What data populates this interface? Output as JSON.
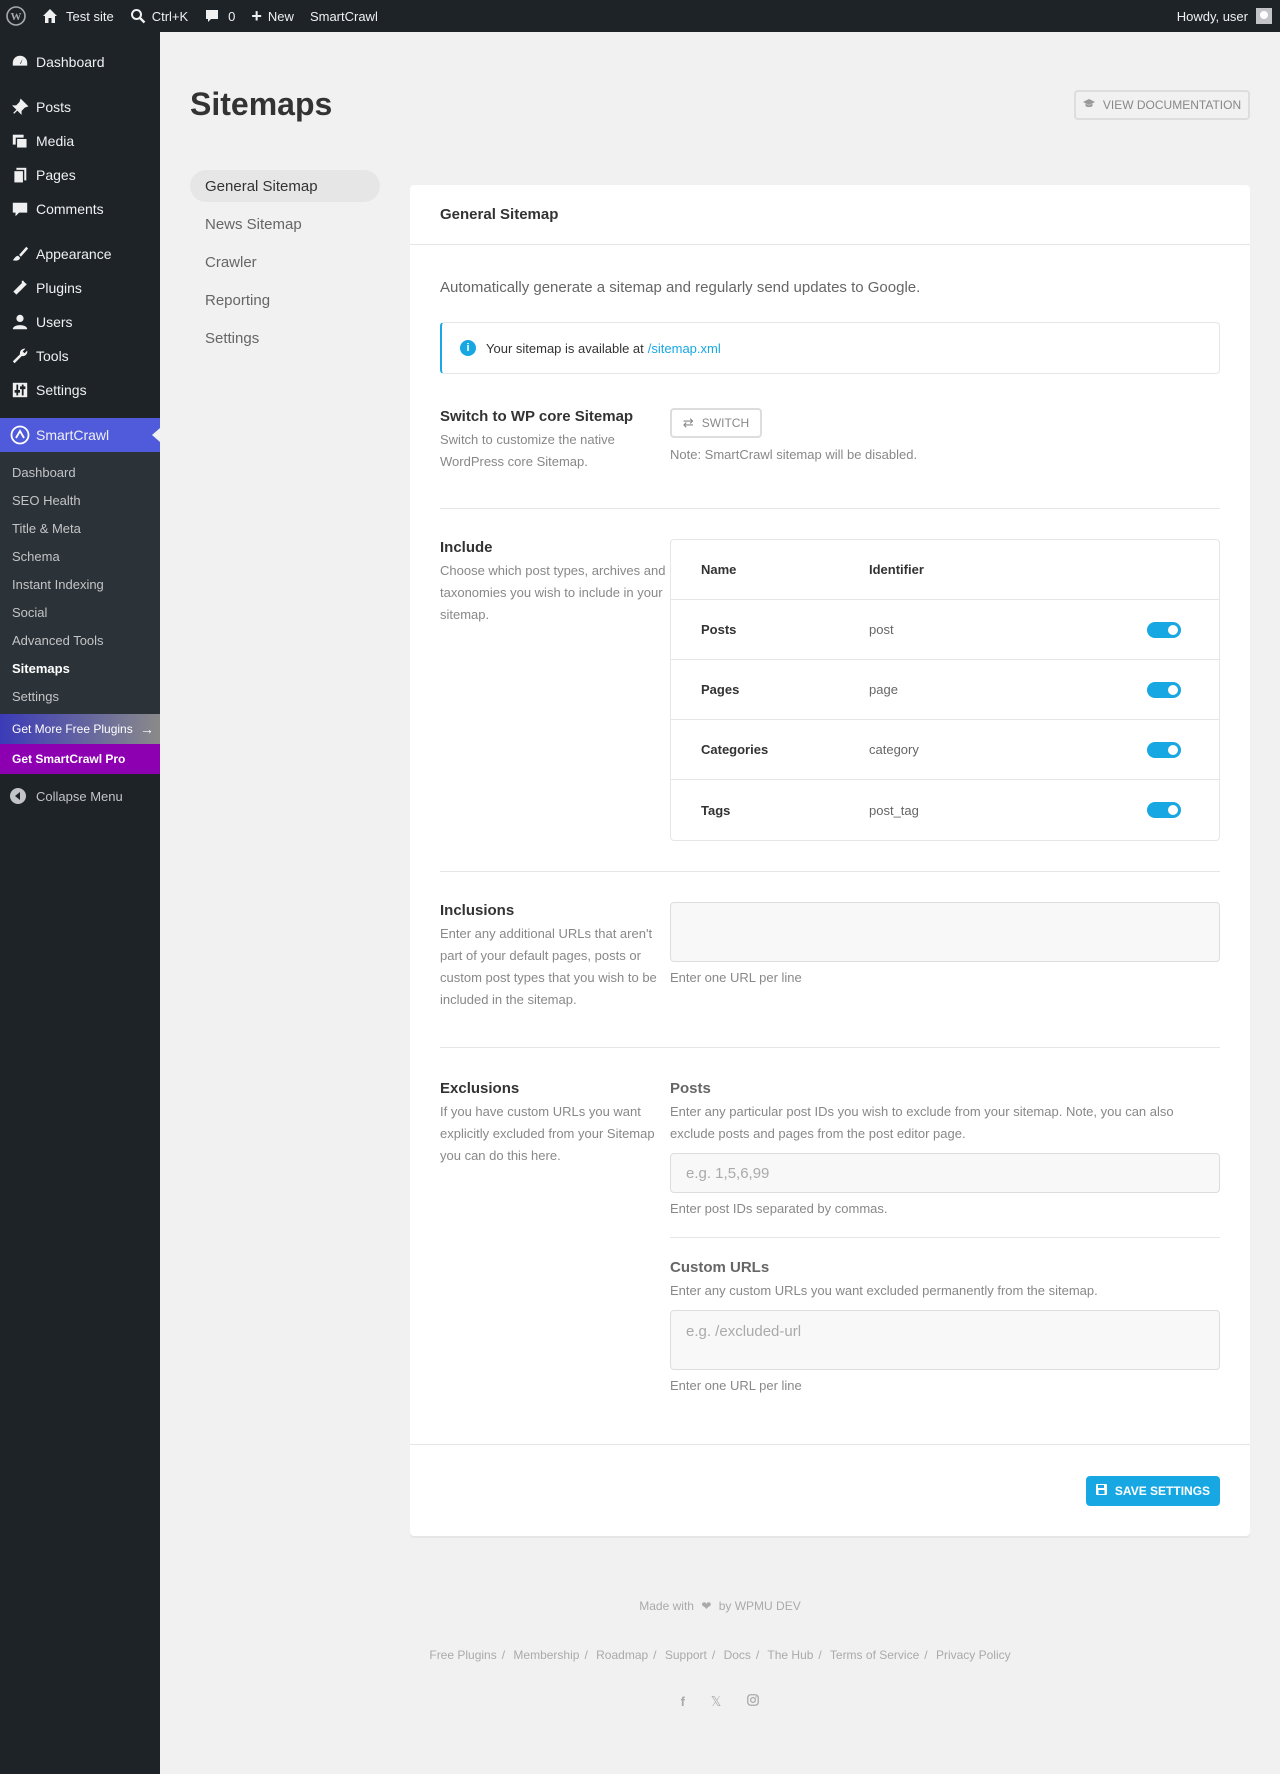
{
  "adminbar": {
    "site_name": "Test site",
    "search_shortcut": "Ctrl+K",
    "comments_count": "0",
    "new_label": "New",
    "plugin_label": "SmartCrawl",
    "howdy": "Howdy, user"
  },
  "sidebar": {
    "items": [
      {
        "label": "Dashboard",
        "icon": "dashboard-icon"
      },
      {
        "label": "Posts",
        "icon": "pin-icon"
      },
      {
        "label": "Media",
        "icon": "media-icon"
      },
      {
        "label": "Pages",
        "icon": "pages-icon"
      },
      {
        "label": "Comments",
        "icon": "comment-icon"
      },
      {
        "label": "Appearance",
        "icon": "brush-icon"
      },
      {
        "label": "Plugins",
        "icon": "plug-icon"
      },
      {
        "label": "Users",
        "icon": "user-icon"
      },
      {
        "label": "Tools",
        "icon": "wrench-icon"
      },
      {
        "label": "Settings",
        "icon": "sliders-icon"
      }
    ],
    "active": {
      "label": "SmartCrawl",
      "icon": "smartcrawl-icon"
    },
    "submenu": [
      "Dashboard",
      "SEO Health",
      "Title & Meta",
      "Schema",
      "Instant Indexing",
      "Social",
      "Advanced Tools",
      "Sitemaps",
      "Settings"
    ],
    "promo1": "Get More Free Plugins",
    "promo2": "Get SmartCrawl Pro",
    "collapse": "Collapse Menu"
  },
  "header": {
    "title": "Sitemaps",
    "doc_button": "View Documentation"
  },
  "tabs": [
    "General Sitemap",
    "News Sitemap",
    "Crawler",
    "Reporting",
    "Settings"
  ],
  "panel": {
    "title": "General Sitemap",
    "intro": "Automatically generate a sitemap and regularly send updates to Google.",
    "notice_text": "Your sitemap is available at",
    "notice_link": "/sitemap.xml",
    "switch": {
      "label": "Switch to WP core Sitemap",
      "desc": "Switch to customize the native WordPress core Sitemap.",
      "button": "Switch",
      "note": "Note: SmartCrawl sitemap will be disabled."
    },
    "include": {
      "label": "Include",
      "desc": "Choose which post types, archives and taxonomies you wish to include in your sitemap.",
      "col_name": "Name",
      "col_identifier": "Identifier",
      "rows": [
        {
          "name": "Posts",
          "identifier": "post",
          "enabled": true
        },
        {
          "name": "Pages",
          "identifier": "page",
          "enabled": true
        },
        {
          "name": "Categories",
          "identifier": "category",
          "enabled": true
        },
        {
          "name": "Tags",
          "identifier": "post_tag",
          "enabled": true
        }
      ]
    },
    "inclusions": {
      "label": "Inclusions",
      "desc": "Enter any additional URLs that aren't part of your default pages, posts or custom post types that you wish to be included in the sitemap.",
      "value": "",
      "help": "Enter one URL per line"
    },
    "exclusions": {
      "label": "Exclusions",
      "desc": "If you have custom URLs you want explicitly excluded from your Sitemap you can do this here.",
      "posts_label": "Posts",
      "posts_desc": "Enter any particular post IDs you wish to exclude from your sitemap. Note, you can also exclude posts and pages from the post editor page.",
      "posts_placeholder": "e.g. 1,5,6,99",
      "posts_help": "Enter post IDs separated by commas.",
      "urls_label": "Custom URLs",
      "urls_desc": "Enter any custom URLs you want excluded permanently from the sitemap.",
      "urls_placeholder": "e.g. /excluded-url",
      "urls_help": "Enter one URL per line"
    },
    "save_button": "Save Settings"
  },
  "footer": {
    "made_with": "Made with",
    "by": "by WPMU DEV",
    "links": [
      "Free Plugins",
      "Membership",
      "Roadmap",
      "Support",
      "Docs",
      "The Hub",
      "Terms of Service",
      "Privacy Policy"
    ],
    "social": [
      "facebook-icon",
      "x-icon",
      "instagram-icon"
    ]
  },
  "colors": {
    "accent": "#17a8e3",
    "smartcrawl_active": "#4f5bdb",
    "admin_dark": "#1d2327",
    "pro_purple": "#8d00b1"
  }
}
